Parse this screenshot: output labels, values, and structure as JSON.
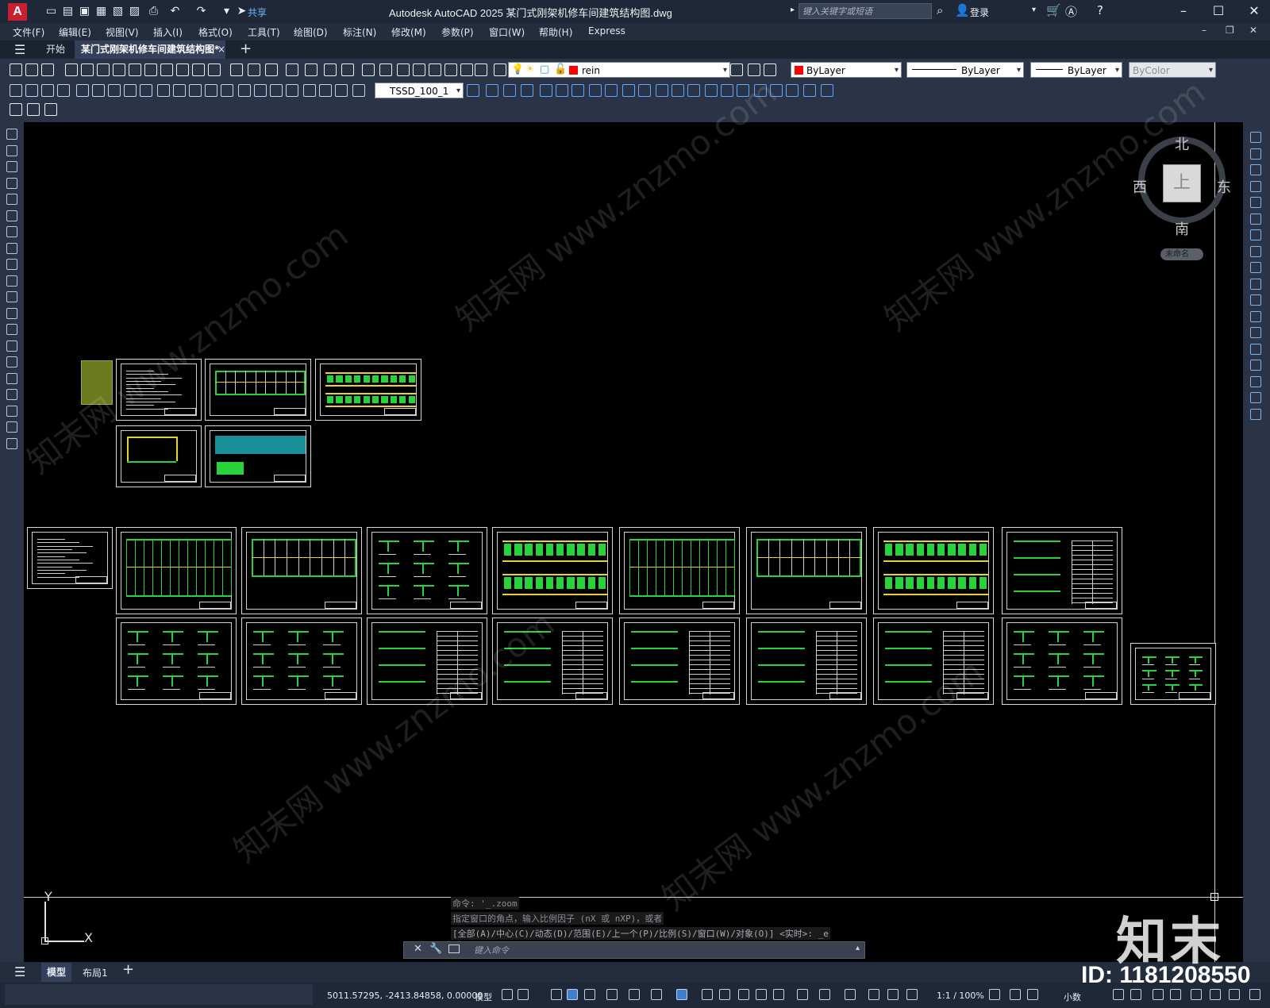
{
  "app": {
    "logo_letter": "A",
    "window_title": "Autodesk AutoCAD 2025    某门式刚架机修车间建筑结构图.dwg",
    "share_label": "共享",
    "search_placeholder": "键入关键字或短语",
    "login_label": "登录"
  },
  "menu": [
    "文件(F)",
    "编辑(E)",
    "视图(V)",
    "插入(I)",
    "格式(O)",
    "工具(T)",
    "绘图(D)",
    "标注(N)",
    "修改(M)",
    "参数(P)",
    "窗口(W)",
    "帮助(H)",
    "Express"
  ],
  "tabs": {
    "start": "开始",
    "document": "某门式刚架机修车间建筑结构图*",
    "close_icon": "×",
    "add_icon": "+"
  },
  "toolbar": {
    "layer_name": "rein",
    "layer_color": "#ff0000",
    "color_combo": "ByLayer",
    "linetype_combo": "ByLayer",
    "lineweight_combo": "ByLayer",
    "plotstyle_combo": "ByColor",
    "dimstyle_combo": "TSSD_100_1"
  },
  "viewcube": {
    "north": "北",
    "south": "南",
    "east": "东",
    "west": "西",
    "face": "上",
    "wcs_label": "未命名"
  },
  "ucs": {
    "x": "X",
    "y": "Y"
  },
  "command_line": {
    "history": [
      "命令: '_.zoom",
      "指定窗口的角点，输入比例因子 (nX 或 nXP)，或者",
      "[全部(A)/中心(C)/动态(D)/范围(E)/上一个(P)/比例(S)/窗口(W)/对象(O)] <实时>: _e"
    ],
    "placeholder": "键入命令"
  },
  "layout_tabs": [
    "模型",
    "布局1"
  ],
  "status": {
    "coordinates": "5011.57295, -2413.84858, 0.00000",
    "space": "模型",
    "scale": "1:1 / 100%",
    "units": "小数"
  },
  "watermarks": {
    "brand": "知末",
    "id_label": "ID: 1181208550",
    "site": "知末网 www.znzmo.com"
  }
}
